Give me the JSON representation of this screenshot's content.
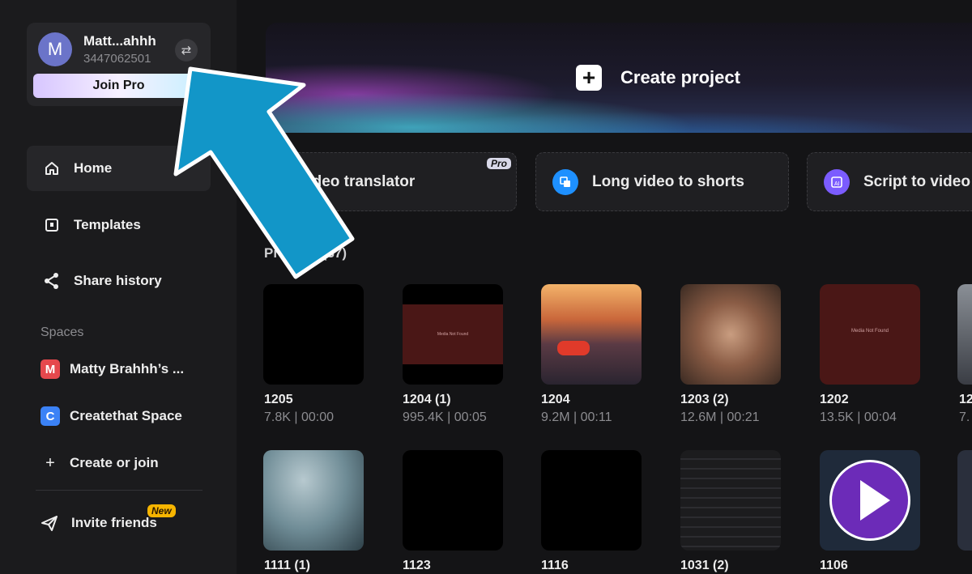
{
  "account": {
    "avatar_letter": "M",
    "name": "Matt...ahhh",
    "id": "3447062501",
    "switch_icon": "swap-arrows-icon",
    "join_pro_label": "Join Pro"
  },
  "nav": {
    "home": "Home",
    "templates": "Templates",
    "share_history": "Share history"
  },
  "spaces": {
    "heading": "Spaces",
    "items": [
      {
        "letter": "M",
        "label": "Matty Brahhh’s ...",
        "color": "#e5484d"
      },
      {
        "letter": "C",
        "label": "Createthat Space",
        "color": "#3b82f6"
      }
    ],
    "create_label": "Create or join"
  },
  "invite": {
    "label": "Invite friends",
    "badge": "New"
  },
  "hero": {
    "create_label": "Create project"
  },
  "tools": [
    {
      "label": "Video translator",
      "badge": "Pro",
      "icon": "translate-icon"
    },
    {
      "label": "Long video to shorts",
      "icon": "shorts-icon",
      "color": "#1e90ff"
    },
    {
      "label": "Script to video",
      "icon": "ai-script-icon",
      "color": "#7b5cff"
    }
  ],
  "projects": {
    "title": "Projects (37)",
    "row1": [
      {
        "name": "1205",
        "meta": "7.8K | 00:00"
      },
      {
        "name": "1204 (1)",
        "meta": "995.4K | 00:05"
      },
      {
        "name": "1204",
        "meta": "9.2M | 00:11"
      },
      {
        "name": "1203 (2)",
        "meta": "12.6M | 00:21"
      },
      {
        "name": "1202",
        "meta": "13.5K | 00:04"
      },
      {
        "name": "12",
        "meta": "7."
      }
    ],
    "row2": [
      {
        "name": "1111 (1)"
      },
      {
        "name": "1123"
      },
      {
        "name": "1116"
      },
      {
        "name": "1031 (2)"
      },
      {
        "name": "1106"
      }
    ],
    "media_not_found": "Media Not Found"
  }
}
